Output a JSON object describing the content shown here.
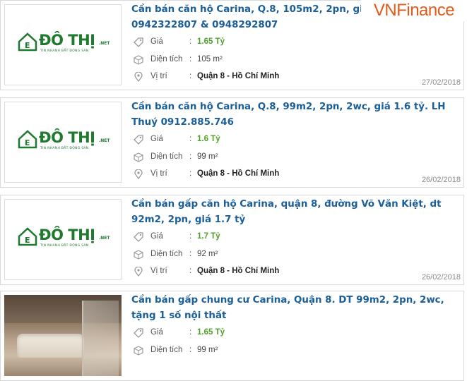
{
  "watermark": "VNFinance",
  "colors": {
    "title": "#1a5e9a",
    "price": "#4fa02a",
    "brand": "#1f7a30",
    "watermark": "#e05a1a"
  },
  "logo": {
    "brand": "ĐÔ THỊ",
    "tld": ".NET",
    "tagline": "TIN NHANH BẤT ĐỘNG SẢN",
    "house_letter": "E"
  },
  "labels": {
    "price": "Giá",
    "area": "Diện tích",
    "location": "Vị trí",
    "colon": ":"
  },
  "icons": {
    "price": "tag-icon",
    "area": "area-icon",
    "location": "map-pin-icon"
  },
  "listings": [
    {
      "title": "Cần bán căn hộ Carina, Q.8, 105m2, 2pn, giá 1,65 tỷ. LH 0942322807 & 0948292807",
      "price": "1.65 Tỷ",
      "area": "105 m²",
      "location": "Quận 8 - Hồ Chí Minh",
      "date": "27/02/2018",
      "thumb": "logo"
    },
    {
      "title": "Cần bán căn hộ Carina, Q.8, 99m2, 2pn, 2wc, giá 1.6 tỷ. LH Thuý 0912.885.746",
      "price": "1.6 Tỷ",
      "area": "99 m²",
      "location": "Quận 8 - Hồ Chí Minh",
      "date": "26/02/2018",
      "thumb": "logo"
    },
    {
      "title": "Cần bán gấp căn hộ Carina, quận 8, đường Võ Văn Kiệt, dt 92m2, 2pn, giá 1.7 tỷ",
      "price": "1.7 Tỷ",
      "area": "92 m²",
      "location": "Quận 8 - Hồ Chí Minh",
      "date": "26/02/2018",
      "thumb": "logo"
    },
    {
      "title": "Cần bán gấp chung cư Carina, Quận 8. DT 99m2, 2pn, 2wc, tặng 1 số nội thất",
      "price": "1.65 Tỷ",
      "area": "99 m²",
      "location": "",
      "date": "",
      "thumb": "photo"
    }
  ]
}
